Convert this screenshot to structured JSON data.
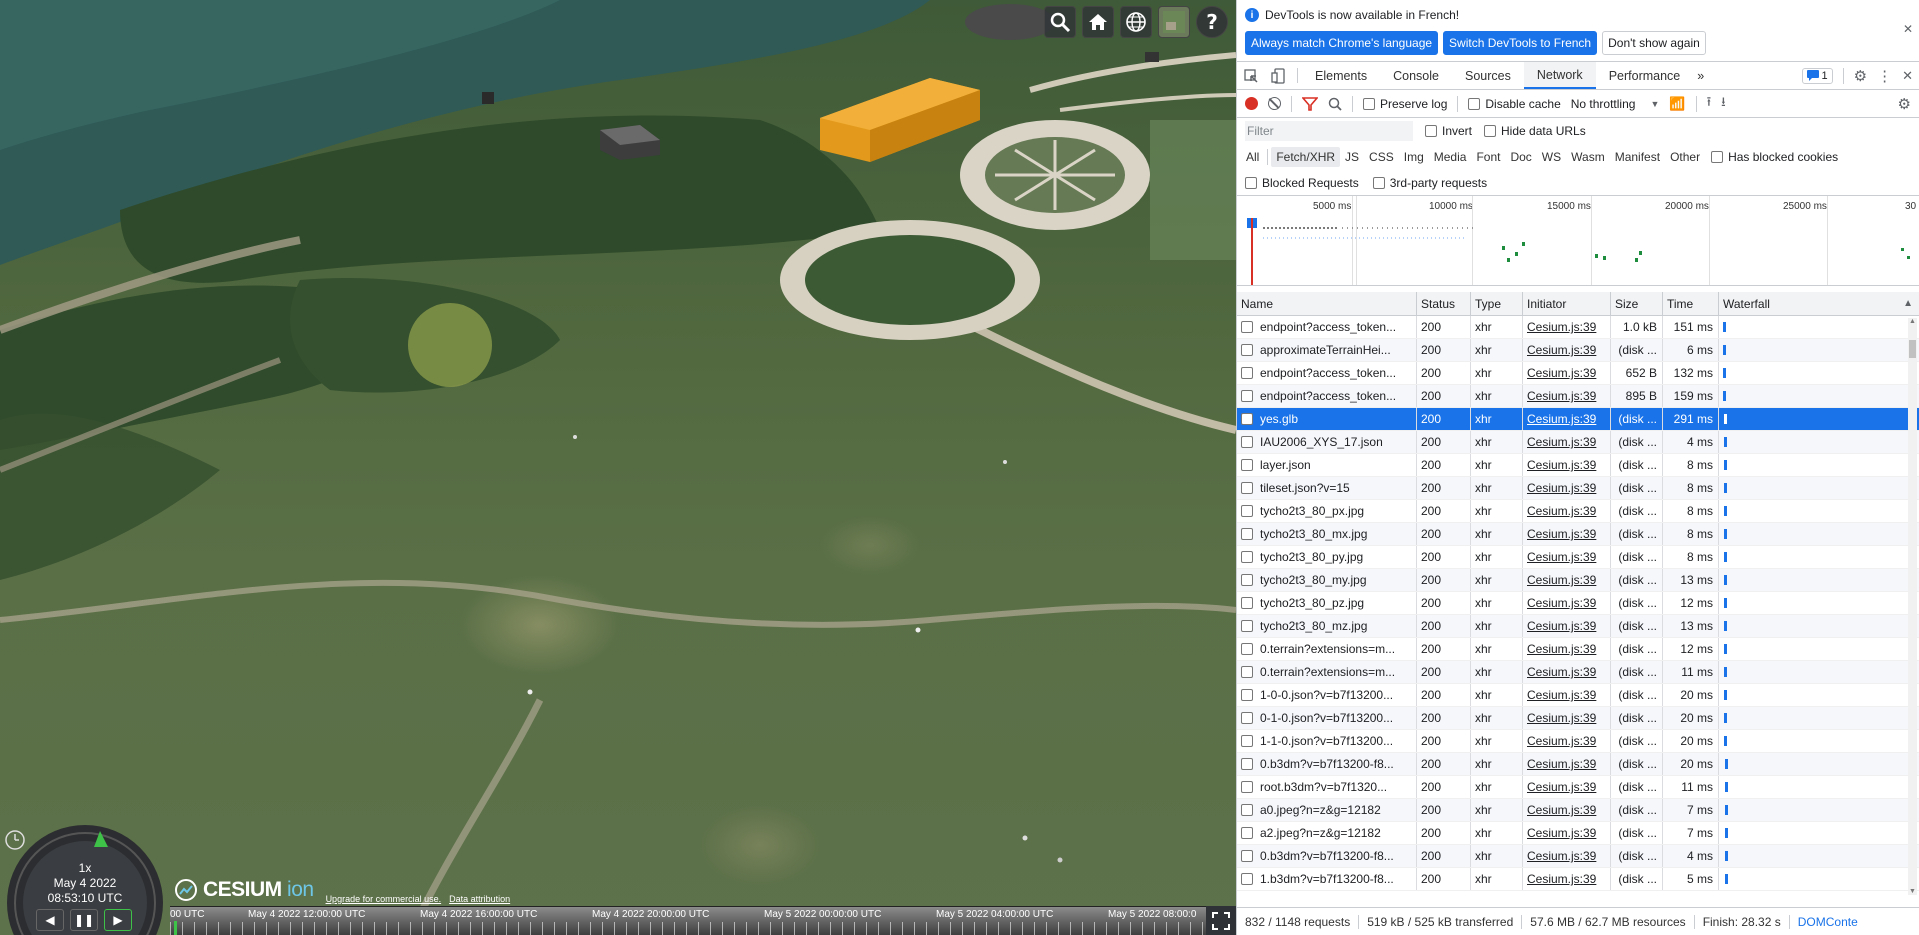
{
  "viewer": {
    "speed": "1x",
    "date": "May 4 2022",
    "time": "08:53:10 UTC",
    "logo_text": "CESIUM",
    "logo_ion": "ion",
    "credit_upgrade": "Upgrade for commercial use.",
    "credit_attribution": "Data attribution",
    "timeline_labels": [
      "00 UTC",
      "May 4 2022 12:00:00 UTC",
      "May 4 2022 16:00:00 UTC",
      "May 4 2022 20:00:00 UTC",
      "May 5 2022 00:00:00 UTC",
      "May 5 2022 04:00:00 UTC",
      "May 5 2022 08:00:0"
    ]
  },
  "infobar": {
    "message": "DevTools is now available in French!",
    "btn_match": "Always match Chrome's language",
    "btn_switch": "Switch DevTools to French",
    "btn_dont": "Don't show again"
  },
  "tabs": [
    "Elements",
    "Console",
    "Sources",
    "Network",
    "Performance"
  ],
  "issues_count": "1",
  "toolbar": {
    "preserve_log": "Preserve log",
    "disable_cache": "Disable cache",
    "throttling": "No throttling"
  },
  "filter": {
    "placeholder": "Filter",
    "invert": "Invert",
    "hide_data": "Hide data URLs"
  },
  "types": [
    "All",
    "Fetch/XHR",
    "JS",
    "CSS",
    "Img",
    "Media",
    "Font",
    "Doc",
    "WS",
    "Wasm",
    "Manifest",
    "Other"
  ],
  "has_blocked_cookies": "Has blocked cookies",
  "blocked_requests": "Blocked Requests",
  "third_party": "3rd-party requests",
  "overview_labels": [
    "5000 ms",
    "10000 ms",
    "15000 ms",
    "20000 ms",
    "25000 ms",
    "30"
  ],
  "columns": [
    "Name",
    "Status",
    "Type",
    "Initiator",
    "Size",
    "Time",
    "Waterfall"
  ],
  "rows": [
    {
      "name": "endpoint?access_token...",
      "status": "200",
      "type": "xhr",
      "initiator": "Cesium.js:39",
      "size": "1.0 kB",
      "time": "151 ms"
    },
    {
      "name": "approximateTerrainHei...",
      "status": "200",
      "type": "xhr",
      "initiator": "Cesium.js:39",
      "size": "(disk ...",
      "time": "6 ms"
    },
    {
      "name": "endpoint?access_token...",
      "status": "200",
      "type": "xhr",
      "initiator": "Cesium.js:39",
      "size": "652 B",
      "time": "132 ms"
    },
    {
      "name": "endpoint?access_token...",
      "status": "200",
      "type": "xhr",
      "initiator": "Cesium.js:39",
      "size": "895 B",
      "time": "159 ms"
    },
    {
      "name": "yes.glb",
      "status": "200",
      "type": "xhr",
      "initiator": "Cesium.js:39",
      "size": "(disk ...",
      "time": "291 ms"
    },
    {
      "name": "IAU2006_XYS_17.json",
      "status": "200",
      "type": "xhr",
      "initiator": "Cesium.js:39",
      "size": "(disk ...",
      "time": "4 ms"
    },
    {
      "name": "layer.json",
      "status": "200",
      "type": "xhr",
      "initiator": "Cesium.js:39",
      "size": "(disk ...",
      "time": "8 ms"
    },
    {
      "name": "tileset.json?v=15",
      "status": "200",
      "type": "xhr",
      "initiator": "Cesium.js:39",
      "size": "(disk ...",
      "time": "8 ms"
    },
    {
      "name": "tycho2t3_80_px.jpg",
      "status": "200",
      "type": "xhr",
      "initiator": "Cesium.js:39",
      "size": "(disk ...",
      "time": "8 ms"
    },
    {
      "name": "tycho2t3_80_mx.jpg",
      "status": "200",
      "type": "xhr",
      "initiator": "Cesium.js:39",
      "size": "(disk ...",
      "time": "8 ms"
    },
    {
      "name": "tycho2t3_80_py.jpg",
      "status": "200",
      "type": "xhr",
      "initiator": "Cesium.js:39",
      "size": "(disk ...",
      "time": "8 ms"
    },
    {
      "name": "tycho2t3_80_my.jpg",
      "status": "200",
      "type": "xhr",
      "initiator": "Cesium.js:39",
      "size": "(disk ...",
      "time": "13 ms"
    },
    {
      "name": "tycho2t3_80_pz.jpg",
      "status": "200",
      "type": "xhr",
      "initiator": "Cesium.js:39",
      "size": "(disk ...",
      "time": "12 ms"
    },
    {
      "name": "tycho2t3_80_mz.jpg",
      "status": "200",
      "type": "xhr",
      "initiator": "Cesium.js:39",
      "size": "(disk ...",
      "time": "13 ms"
    },
    {
      "name": "0.terrain?extensions=m...",
      "status": "200",
      "type": "xhr",
      "initiator": "Cesium.js:39",
      "size": "(disk ...",
      "time": "12 ms"
    },
    {
      "name": "0.terrain?extensions=m...",
      "status": "200",
      "type": "xhr",
      "initiator": "Cesium.js:39",
      "size": "(disk ...",
      "time": "11 ms"
    },
    {
      "name": "1-0-0.json?v=b7f13200...",
      "status": "200",
      "type": "xhr",
      "initiator": "Cesium.js:39",
      "size": "(disk ...",
      "time": "20 ms"
    },
    {
      "name": "0-1-0.json?v=b7f13200...",
      "status": "200",
      "type": "xhr",
      "initiator": "Cesium.js:39",
      "size": "(disk ...",
      "time": "20 ms"
    },
    {
      "name": "1-1-0.json?v=b7f13200...",
      "status": "200",
      "type": "xhr",
      "initiator": "Cesium.js:39",
      "size": "(disk ...",
      "time": "20 ms"
    },
    {
      "name": "0.b3dm?v=b7f13200-f8...",
      "status": "200",
      "type": "xhr",
      "initiator": "Cesium.js:39",
      "size": "(disk ...",
      "time": "20 ms"
    },
    {
      "name": "root.b3dm?v=b7f1320...",
      "status": "200",
      "type": "xhr",
      "initiator": "Cesium.js:39",
      "size": "(disk ...",
      "time": "11 ms"
    },
    {
      "name": "a0.jpeg?n=z&g=12182",
      "status": "200",
      "type": "xhr",
      "initiator": "Cesium.js:39",
      "size": "(disk ...",
      "time": "7 ms"
    },
    {
      "name": "a2.jpeg?n=z&g=12182",
      "status": "200",
      "type": "xhr",
      "initiator": "Cesium.js:39",
      "size": "(disk ...",
      "time": "7 ms"
    },
    {
      "name": "0.b3dm?v=b7f13200-f8...",
      "status": "200",
      "type": "xhr",
      "initiator": "Cesium.js:39",
      "size": "(disk ...",
      "time": "4 ms"
    },
    {
      "name": "1.b3dm?v=b7f13200-f8...",
      "status": "200",
      "type": "xhr",
      "initiator": "Cesium.js:39",
      "size": "(disk ...",
      "time": "5 ms"
    }
  ],
  "selected_row": 4,
  "status": {
    "requests": "832 / 1148 requests",
    "transferred": "519 kB / 525 kB transferred",
    "resources": "57.6 MB / 62.7 MB resources",
    "finish": "Finish: 28.32 s",
    "domcontent": "DOMConte"
  },
  "colors": {
    "accent": "#1a73e8",
    "building": "#e39a1c"
  }
}
